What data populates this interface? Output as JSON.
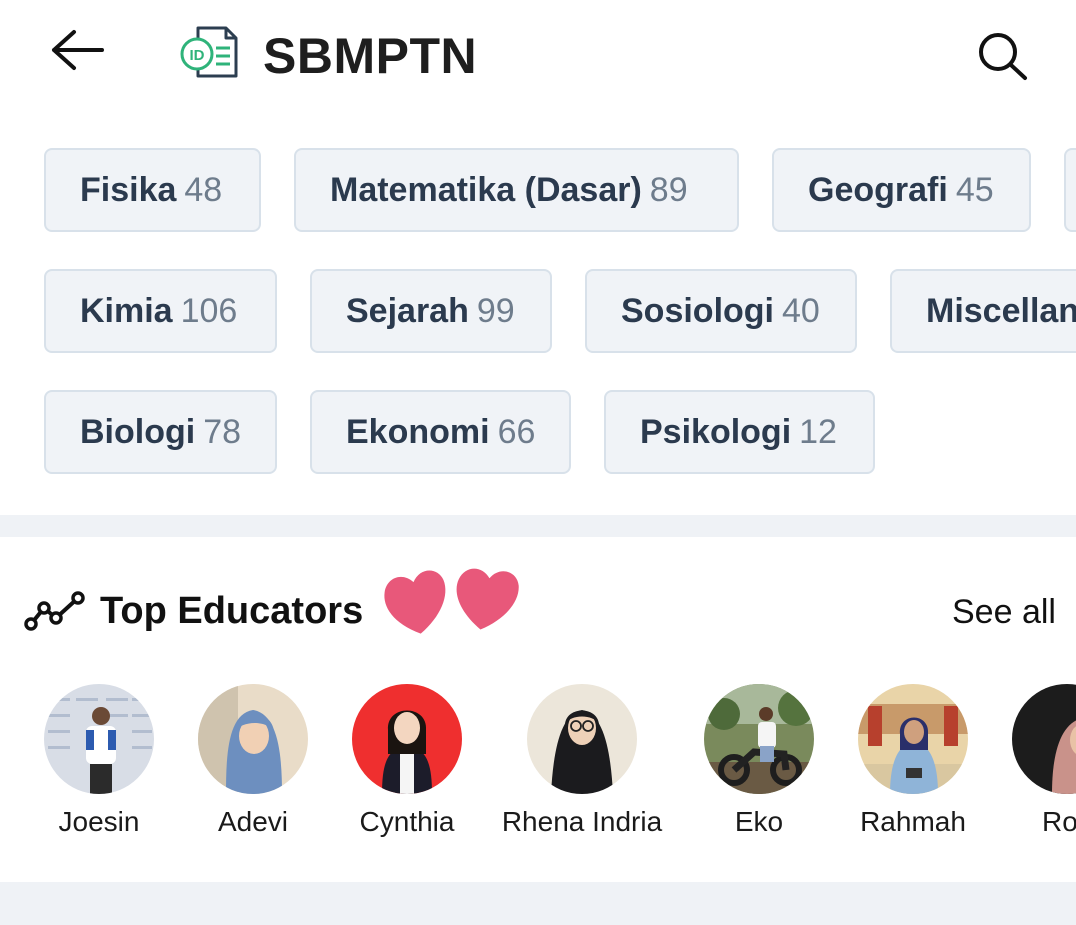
{
  "header": {
    "title": "SBMPTN",
    "logo_text": "ID"
  },
  "subjects": [
    {
      "name": "Fisika",
      "count": "48"
    },
    {
      "name": "Matematika (Dasar)",
      "count": "89"
    },
    {
      "name": "Geografi",
      "count": "45"
    },
    {
      "name": "Kimia",
      "count": "106"
    },
    {
      "name": "Sejarah",
      "count": "99"
    },
    {
      "name": "Sosiologi",
      "count": "40"
    },
    {
      "name": "Miscellan",
      "count": ""
    },
    {
      "name": "Biologi",
      "count": "78"
    },
    {
      "name": "Ekonomi",
      "count": "66"
    },
    {
      "name": "Psikologi",
      "count": "12"
    }
  ],
  "educators_section": {
    "title": "Top Educators",
    "see_all": "See all",
    "educators": [
      {
        "name": "Joesin"
      },
      {
        "name": "Adevi"
      },
      {
        "name": "Cynthia"
      },
      {
        "name": "Rhena Indria"
      },
      {
        "name": "Eko"
      },
      {
        "name": "Rahmah"
      },
      {
        "name": "Ros"
      }
    ]
  },
  "colors": {
    "chip_bg": "#f0f3f7",
    "chip_border": "#d8e1ea",
    "logo_green": "#2fb37a",
    "heart": "#e8587a",
    "divider": "#eff2f6"
  },
  "icons": {
    "back": "arrow-left-icon",
    "search": "search-icon",
    "trend": "trend-line-icon",
    "hearts": "heart-icon"
  }
}
